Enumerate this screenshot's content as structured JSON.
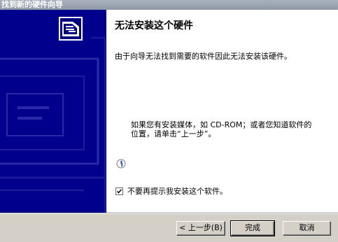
{
  "window": {
    "title": "找到新的硬件向导"
  },
  "sidebar": {
    "icon": "hardware-box-icon",
    "background_color": "#00008c"
  },
  "main": {
    "heading": "无法安装这个硬件",
    "description": "由于向导无法找到需要的软件因此无法安装该硬件。",
    "hint_line1": "如果您有安装媒体，如 CD-ROM；或者您知道软件的",
    "hint_line2": "位置，请单击“上一步”。",
    "info_icon": "info-icon",
    "checkbox": {
      "label": "不要再提示我安装这个软件。",
      "checked": true
    }
  },
  "footer": {
    "back_label": "< 上一步(B)",
    "finish_label": "完成",
    "cancel_label": "取消"
  }
}
